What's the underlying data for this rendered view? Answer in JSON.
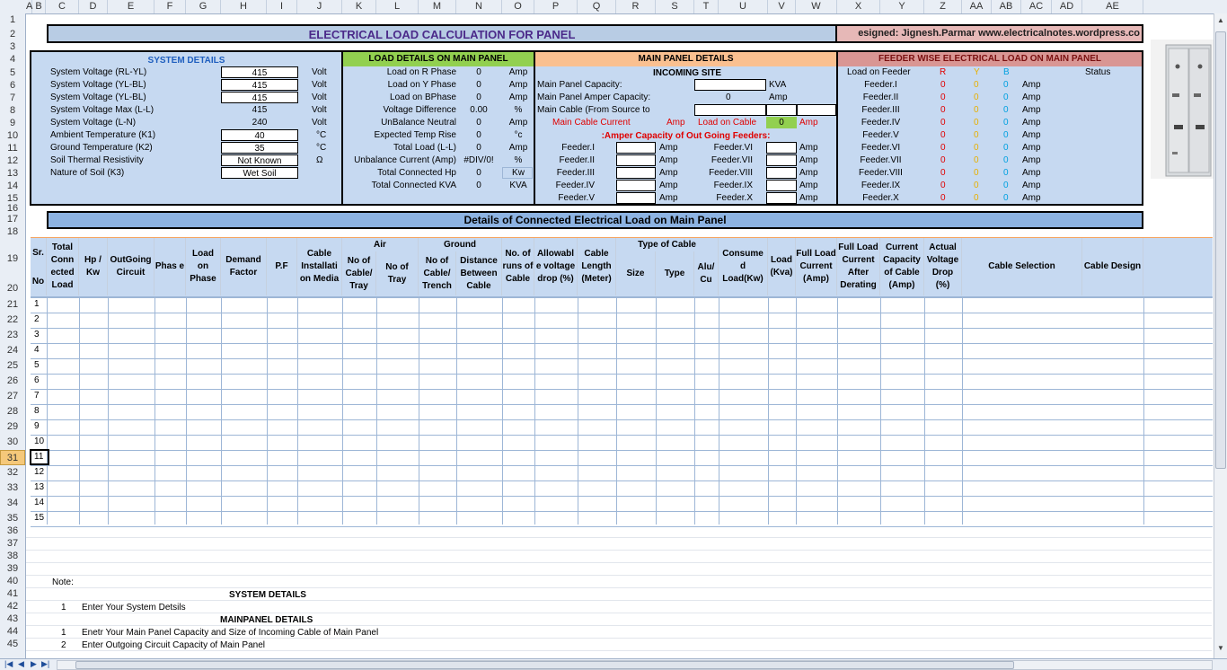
{
  "columns": [
    "A",
    "B",
    "C",
    "D",
    "E",
    "F",
    "G",
    "H",
    "I",
    "J",
    "K",
    "L",
    "M",
    "N",
    "O",
    "P",
    "Q",
    "R",
    "S",
    "T",
    "U",
    "V",
    "W",
    "X",
    "Y",
    "Z",
    "AA",
    "AB",
    "AC",
    "AD",
    "AE"
  ],
  "rows": [
    "1",
    "2",
    "3",
    "4",
    "5",
    "6",
    "7",
    "8",
    "9",
    "10",
    "11",
    "12",
    "13",
    "14",
    "15",
    "16",
    "17",
    "18",
    "19",
    "20",
    "21",
    "22",
    "23",
    "24",
    "25",
    "26",
    "27",
    "28",
    "29",
    "30",
    "31",
    "32",
    "33",
    "34",
    "35",
    "36",
    "37",
    "38",
    "39",
    "40",
    "41",
    "42",
    "43",
    "44",
    "45"
  ],
  "selected_row": "31",
  "title": "ELECTRICAL LOAD CALCULATION FOR PANEL",
  "designer": "esigned: Jignesh.Parmar  www.electricalnotes.wordpress.co",
  "system": {
    "title": "SYSTEM DETAILS",
    "rows": [
      {
        "label": "System Voltage (RL-YL)",
        "value": "415",
        "unit": "Volt",
        "box": true
      },
      {
        "label": "System Voltage (YL-BL)",
        "value": "415",
        "unit": "Volt",
        "box": true
      },
      {
        "label": "System Voltage (YL-BL)",
        "value": "415",
        "unit": "Volt",
        "box": true
      },
      {
        "label": "System Voltage Max (L-L)",
        "value": "415",
        "unit": "Volt",
        "box": false
      },
      {
        "label": "System Voltage (L-N)",
        "value": "240",
        "unit": "Volt",
        "box": false
      },
      {
        "label": "Ambient Temperature (K1)",
        "value": "40",
        "unit": "°C",
        "box": true
      },
      {
        "label": "Ground Temperature (K2)",
        "value": "35",
        "unit": "°C",
        "box": true
      },
      {
        "label": "Soil Thermal Resistivity",
        "value": "Not Known",
        "unit": "Ω",
        "box": true
      },
      {
        "label": "Nature of Soil (K3)",
        "value": "Wet Soil",
        "unit": "",
        "box": true
      }
    ]
  },
  "load": {
    "title": "LOAD DETAILS ON MAIN PANEL",
    "rows": [
      {
        "label": "Load on R Phase",
        "value": "0",
        "unit": "Amp"
      },
      {
        "label": "Load on Y Phase",
        "value": "0",
        "unit": "Amp"
      },
      {
        "label": "Load on BPhase",
        "value": "0",
        "unit": "Amp"
      },
      {
        "label": "Voltage Difference",
        "value": "0.00",
        "unit": "%"
      },
      {
        "label": "UnBalance Neutral",
        "value": "0",
        "unit": "Amp"
      },
      {
        "label": "Expected Temp Rise",
        "value": "0",
        "unit": "°c"
      },
      {
        "label": "Total Load (L-L)",
        "value": "0",
        "unit": "Amp"
      },
      {
        "label": "Unbalance Current (Amp)",
        "value": "#DIV/0!",
        "unit": "%"
      },
      {
        "label": "Total Connected Hp",
        "value": "0",
        "unit": "Kw"
      },
      {
        "label": "Total Connected KVA",
        "value": "0",
        "unit": "KVA"
      }
    ]
  },
  "main": {
    "title": "MAIN PANEL DETAILS",
    "incoming": "INCOMING SITE",
    "capacity_label": "Main Panel Capacity:",
    "capacity_unit": "KVA",
    "amper_label": "Main Panel Amper Capacity:",
    "amper_value": "0",
    "amper_unit": "Amp",
    "cable_label": "Main Cable (From Source to",
    "cable_current_label": "Main Cable Current",
    "cable_current_unit": "Amp",
    "load_on_cable_label": "Load on Cable",
    "load_on_cable_value": "0",
    "load_on_cable_unit": "Amp",
    "outgoing_title": ":Amper Capacity of Out Going Feeders:",
    "feeders_left": [
      "Feeder.I",
      "Feeder.II",
      "Feeder.III",
      "Feeder.IV",
      "Feeder.V"
    ],
    "feeders_right": [
      "Feeder.VI",
      "Feeder.VII",
      "Feeder.VIII",
      "Feeder.IX",
      "Feeder.X"
    ],
    "amp": "Amp"
  },
  "feeder": {
    "title": "FEEDER WISE ELECTRICAL LOAD ON MAIN PANEL",
    "load_label": "Load on Feeder",
    "r": "R",
    "y": "Y",
    "b": "B",
    "status": "Status",
    "rows": [
      "Feeder.I",
      "Feeder.II",
      "Feeder.III",
      "Feeder.IV",
      "Feeder.V",
      "Feeder.VI",
      "Feeder.VII",
      "Feeder.VIII",
      "Feeder.IX",
      "Feeder.X"
    ],
    "zero": "0",
    "amp": "Amp"
  },
  "details_title": "Details of Connected Electrical Load on Main Panel",
  "table": {
    "headers": {
      "sr": "Sr.",
      "no": "No",
      "total": "Total Conn ected Load",
      "hp": "Hp / Kw",
      "outgoing": "OutGoing Circuit",
      "phase": "Phas e",
      "loadphase": "Load on Phase",
      "demand": "Demand Factor",
      "pf": "P.F",
      "install": "Cable Installati on Media",
      "air": "Air",
      "air1": "No of Cable/ Tray",
      "air2": "No of Tray",
      "ground": "Ground",
      "g1": "No of Cable/ Trench",
      "g2": "Distance Between Cable",
      "runs": "No. of runs of Cable",
      "allow": "Allowabl e voltage drop (%)",
      "length": "Cable Length (Meter)",
      "type_of_cable": "Type of Cable",
      "size": "Size",
      "type": "Type",
      "alu": "Alu/ Cu",
      "consumed": "Consume d Load(Kw)",
      "loadkva": "Load (Kva)",
      "flc": "Full Load Current (Amp)",
      "flcad": "Full Load Current After Derating",
      "capacity": "Current Capacity of Cable (Amp)",
      "vdrop": "Actual Voltage Drop (%)",
      "selection": "Cable Selection",
      "design": "Cable Design"
    },
    "serials": [
      "1",
      "2",
      "3",
      "4",
      "5",
      "6",
      "7",
      "8",
      "9",
      "10",
      "11",
      "12",
      "13",
      "14",
      "15"
    ]
  },
  "notes": {
    "note": "Note:",
    "sys_title": "SYSTEM DETAILS",
    "n1_num": "1",
    "n1": "Enter Your System Detsils",
    "main_title": "MAINPANEL DETAILS",
    "n2_num": "1",
    "n2": "Enetr Your Main Panel Capacity and Size of Incoming Cable of Main Panel",
    "n3_num": "2",
    "n3": "Enter Outgoing Circuit Capacity of Main Panel"
  }
}
